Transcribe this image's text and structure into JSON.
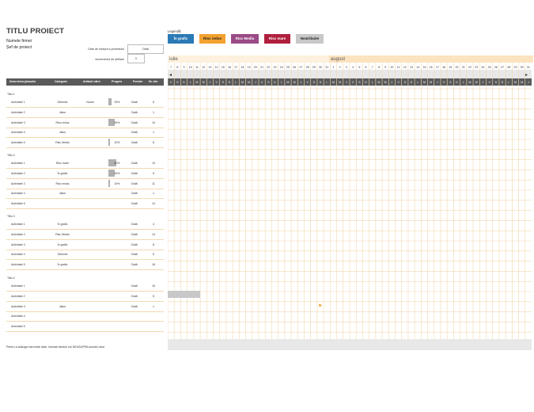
{
  "header": {
    "title": "TITLU PROIECT",
    "company": "Numele firmei",
    "manager": "Șef de proiect",
    "start_label": "Data de început a proiectului",
    "start_value": "Dată",
    "increment_label": "Incrementul de defilare",
    "increment_value": "0"
  },
  "legend": {
    "label": "Legendă:",
    "items": [
      {
        "label": "În grafic",
        "bg": "#2a7ab5",
        "fg": "#ffffff"
      },
      {
        "label": "Risc redus",
        "bg": "#f3a22f",
        "fg": "#222222"
      },
      {
        "label": "Risc Mediu",
        "bg": "#9a4b86",
        "fg": "#ffffff"
      },
      {
        "label": "Risc mare",
        "bg": "#b0203e",
        "fg": "#ffffff"
      },
      {
        "label": "Neatribuite",
        "bg": "#c8c8c8",
        "fg": "#222222"
      }
    ]
  },
  "timeline": {
    "months": [
      "iulie",
      "august"
    ],
    "days_july": [
      "7",
      "8",
      "9",
      "10",
      "11",
      "12",
      "13",
      "14",
      "15",
      "16",
      "17",
      "18",
      "19",
      "20",
      "21",
      "22",
      "23",
      "24",
      "25",
      "26",
      "27",
      "28",
      "29",
      "30",
      "31"
    ],
    "days_august": [
      "1",
      "2",
      "3",
      "4",
      "5",
      "6",
      "7",
      "8",
      "9",
      "10",
      "11",
      "12",
      "13",
      "14",
      "15",
      "16",
      "17",
      "18",
      "19",
      "20",
      "21",
      "22",
      "23",
      "24",
      "25",
      "26",
      "27",
      "28",
      "29",
      "30",
      "31"
    ],
    "weekday_letters": [
      "V",
      "S",
      "D",
      "L",
      "M",
      "M",
      "J"
    ]
  },
  "table": {
    "headers": [
      "Descrierea jalonului",
      "Categorie",
      "Atribuit către",
      "Progres",
      "Pornire",
      "Nr. zile"
    ],
    "groups": [
      {
        "name": "Titlu 1",
        "rows": [
          {
            "task": "Activitate 1",
            "cat": "Obiectiv",
            "assigned": "Nume",
            "progress": "25%",
            "start": "Dată",
            "days": "5"
          },
          {
            "task": "Activitate 2",
            "cat": "Jalon",
            "assigned": "",
            "progress": "",
            "start": "Dată",
            "days": "1"
          },
          {
            "task": "Activitate 3",
            "cat": "Risc redus",
            "assigned": "",
            "progress": "50%",
            "start": "Dată",
            "days": "10"
          },
          {
            "task": "Activitate 4",
            "cat": "Jalon",
            "assigned": "",
            "progress": "",
            "start": "Dată",
            "days": "1"
          },
          {
            "task": "Activitate 5",
            "cat": "Risc Mediu",
            "assigned": "",
            "progress": "10%",
            "start": "Dată",
            "days": "8"
          }
        ]
      },
      {
        "name": "Titlu 2",
        "rows": [
          {
            "task": "Activitate 1",
            "cat": "Risc mare",
            "assigned": "",
            "progress": "60%",
            "start": "Dată",
            "days": "13"
          },
          {
            "task": "Activitate 2",
            "cat": "În grafic",
            "assigned": "",
            "progress": "50%",
            "start": "Dată",
            "days": "6"
          },
          {
            "task": "Activitate 3",
            "cat": "Risc redus",
            "assigned": "",
            "progress": "10%",
            "start": "Dată",
            "days": "11"
          },
          {
            "task": "Activitate 4",
            "cat": "Jalon",
            "assigned": "",
            "progress": "",
            "start": "Dată",
            "days": "1"
          },
          {
            "task": "Activitate 5",
            "cat": "",
            "assigned": "",
            "progress": "",
            "start": "Dată",
            "days": "14"
          }
        ]
      },
      {
        "name": "Titlu 3",
        "rows": [
          {
            "task": "Activitate 1",
            "cat": "În grafic",
            "assigned": "",
            "progress": "",
            "start": "Dată",
            "days": "4"
          },
          {
            "task": "Activitate 2",
            "cat": "Risc Mediu",
            "assigned": "",
            "progress": "",
            "start": "Dată",
            "days": "14"
          },
          {
            "task": "Activitate 3",
            "cat": "În grafic",
            "assigned": "",
            "progress": "",
            "start": "Dată",
            "days": "8"
          },
          {
            "task": "Activitate 4",
            "cat": "Obiectiv",
            "assigned": "",
            "progress": "",
            "start": "Dată",
            "days": "5"
          },
          {
            "task": "Activitate 5",
            "cat": "În grafic",
            "assigned": "",
            "progress": "",
            "start": "Dată",
            "days": "18"
          }
        ]
      },
      {
        "name": "Titlu 4",
        "rows": [
          {
            "task": "Activitate 1",
            "cat": "",
            "assigned": "",
            "progress": "",
            "start": "Dată",
            "days": "15"
          },
          {
            "task": "Activitate 2",
            "cat": "",
            "assigned": "",
            "progress": "",
            "start": "Dată",
            "days": "5"
          },
          {
            "task": "Activitate 3",
            "cat": "Jalon",
            "assigned": "",
            "progress": "",
            "start": "Dată",
            "days": "1"
          },
          {
            "task": "Activitate 4",
            "cat": "",
            "assigned": "",
            "progress": "",
            "start": "",
            "days": ""
          },
          {
            "task": "Activitate 5",
            "cat": "",
            "assigned": "",
            "progress": "",
            "start": "",
            "days": ""
          }
        ]
      }
    ]
  },
  "footer": "Pentru a adăuga mai multe date, inserați rânduri noi DEASUPRA acestui rând",
  "milestone_flag": "⚑",
  "colors": {
    "header_dark": "#5a5a5a",
    "grid_line": "#f2d8b0",
    "month_band": "#fbe3bf",
    "bar_gray": "#b0b0b0"
  }
}
